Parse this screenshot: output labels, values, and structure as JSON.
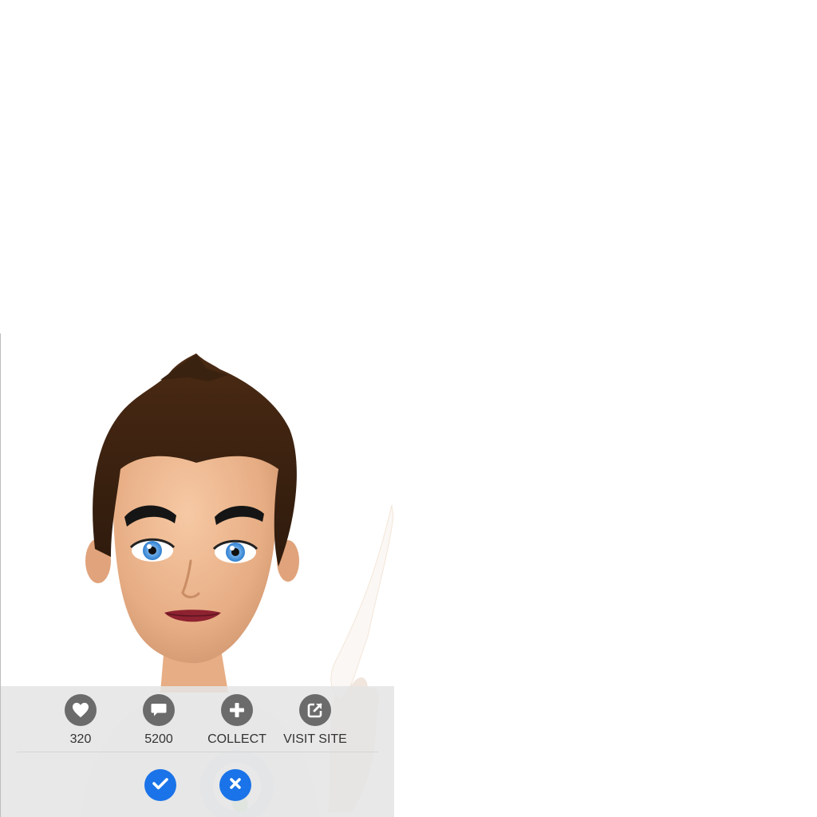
{
  "actions": {
    "likes": {
      "label": "320",
      "icon": "heart-icon"
    },
    "comments": {
      "label": "5200",
      "icon": "speech-bubble-icon"
    },
    "collect": {
      "label": "COLLECT",
      "icon": "plus-icon"
    },
    "visit": {
      "label": "VISIT SITE",
      "icon": "external-link-icon"
    }
  },
  "decisions": {
    "accept": {
      "icon": "checkmark-icon"
    },
    "reject": {
      "icon": "x-icon"
    }
  },
  "colors": {
    "action_icon_bg": "#6b6b6b",
    "decision_bg": "#1a73e8",
    "bar_bg": "#e4e4e4",
    "label_text": "#333333"
  }
}
